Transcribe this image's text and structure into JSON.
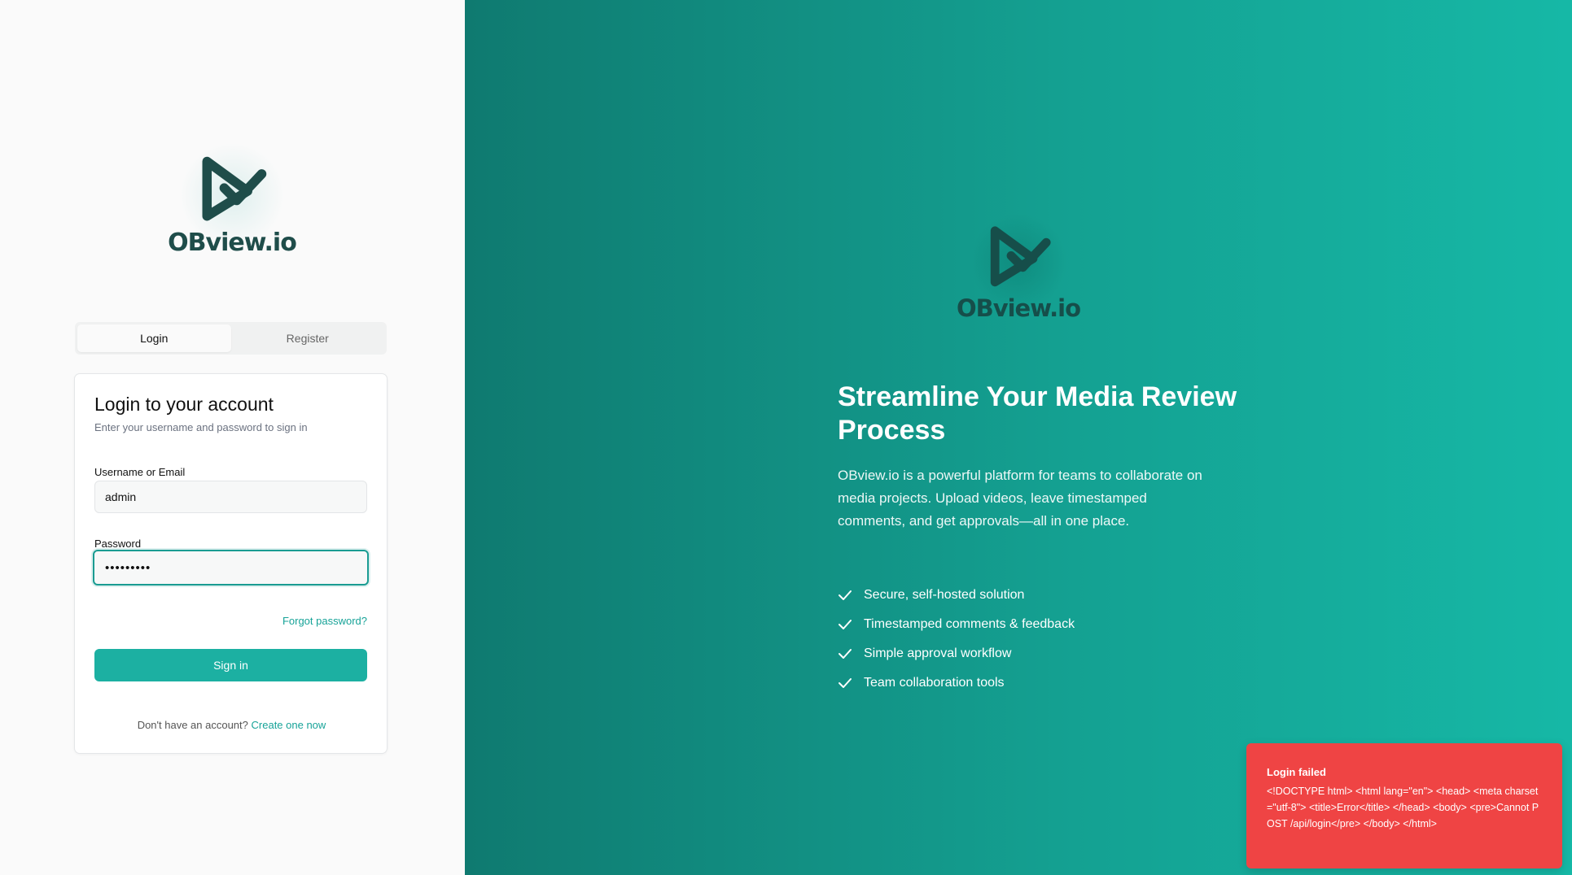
{
  "brand": {
    "name": "OBview.io",
    "accent": "#1cb0a2"
  },
  "tabs": [
    {
      "label": "Login",
      "active": true
    },
    {
      "label": "Register",
      "active": false
    }
  ],
  "login": {
    "title": "Login to your account",
    "subtitle": "Enter your username and password to sign in",
    "username_label": "Username or Email",
    "username_value": "admin",
    "password_label": "Password",
    "password_value": "•••••••••",
    "forgot": "Forgot password?",
    "submit": "Sign in",
    "no_account": "Don't have an account?",
    "create": "Create one now"
  },
  "hero": {
    "headline": "Streamline Your Media Review Process",
    "description": "OBview.io is a powerful platform for teams to collaborate on media projects. Upload videos, leave timestamped comments, and get approvals—all in one place.",
    "features": [
      "Secure, self-hosted solution",
      "Timestamped comments & feedback",
      "Simple approval workflow",
      "Team collaboration tools"
    ]
  },
  "toast": {
    "title": "Login failed",
    "message": "<!DOCTYPE html> <html lang=\"en\"> <head> <meta charset=\"utf-8\"> <title>Error</title> </head> <body> <pre>Cannot POST /api/login</pre> </body> </html>",
    "color": "#ef4444"
  }
}
